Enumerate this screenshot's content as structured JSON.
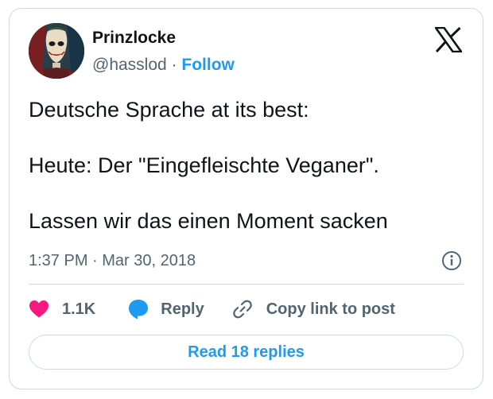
{
  "author": {
    "display_name": "Prinzlocke",
    "handle": "@hasslod",
    "separator": "·",
    "follow_label": "Follow"
  },
  "tweet": {
    "paragraphs": [
      "Deutsche Sprache at its best:",
      "Heute: Der \"Eingefleischte Veganer\".",
      "Lassen wir das einen Moment sacken"
    ],
    "timestamp": "1:37 PM · Mar 30, 2018"
  },
  "actions": {
    "like_count": "1.1K",
    "reply_label": "Reply",
    "copy_link_label": "Copy link to post"
  },
  "read_replies_label": "Read 18 replies",
  "icons": {
    "platform": "x-logo-icon",
    "info": "info-icon",
    "like": "heart-icon",
    "reply": "speech-bubble-icon",
    "copy": "link-icon"
  },
  "colors": {
    "accent": "#1d9bf0",
    "like": "#f91880",
    "secondary_text": "#536471",
    "border": "#cfd9de"
  }
}
